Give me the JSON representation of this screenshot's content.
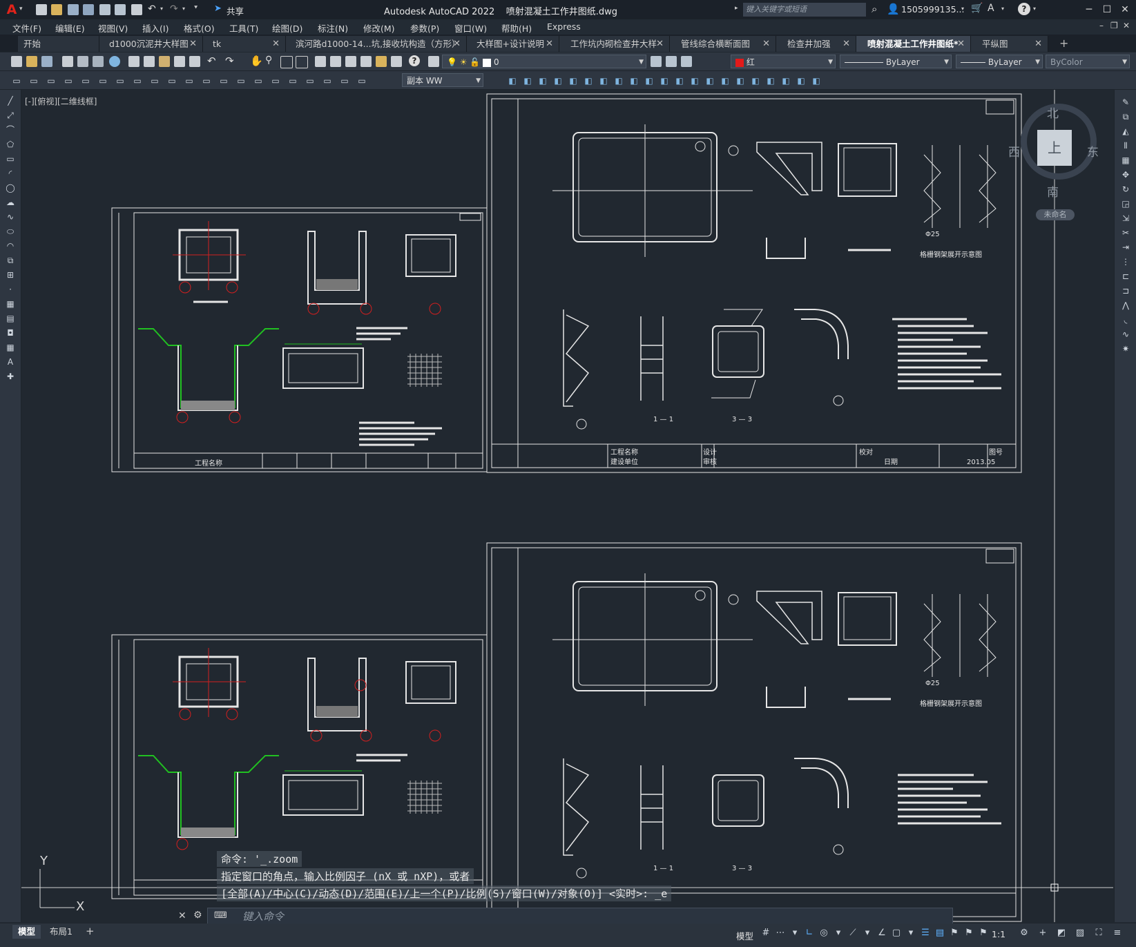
{
  "app": {
    "title": "Autodesk AutoCAD 2022",
    "filename": "喷射混凝土工作井图纸.dwg",
    "share_label": "共享",
    "search_placeholder": "键入关键字或短语",
    "user": "1505999135...",
    "help": "?"
  },
  "menu": [
    "文件(F)",
    "编辑(E)",
    "视图(V)",
    "插入(I)",
    "格式(O)",
    "工具(T)",
    "绘图(D)",
    "标注(N)",
    "修改(M)",
    "参数(P)",
    "窗口(W)",
    "帮助(H)",
    "Express"
  ],
  "tabs": [
    {
      "label": "开始",
      "active": false,
      "closable": false
    },
    {
      "label": "d1000沉泥井大样图",
      "active": false,
      "closable": true
    },
    {
      "label": "tk",
      "active": false,
      "closable": true
    },
    {
      "label": "滨河路d1000-14...坑,接收坑构造（方形）",
      "active": false,
      "closable": true
    },
    {
      "label": "大样图+设计说明",
      "active": false,
      "closable": true
    },
    {
      "label": "工作坑内砌检查井大样",
      "active": false,
      "closable": true
    },
    {
      "label": "管线综合横断面图",
      "active": false,
      "closable": true
    },
    {
      "label": "检查井加强",
      "active": false,
      "closable": true
    },
    {
      "label": "喷射混凝土工作井图纸*",
      "active": true,
      "closable": true
    },
    {
      "label": "平纵图",
      "active": false,
      "closable": true
    }
  ],
  "toolbar": {
    "layer_value": "0",
    "color_value": "红",
    "linetype_value": "ByLayer",
    "lineweight_value": "ByLayer",
    "plotstyle_value": "ByColor",
    "dimstyle_value": "副本 WW"
  },
  "viewport_label": "[-][俯视][二维线框]",
  "viewcube": {
    "north": "北",
    "south": "南",
    "east": "东",
    "west": "西",
    "face": "上",
    "ucs_name": "未命名"
  },
  "ucs": {
    "y": "Y",
    "x": "X"
  },
  "command": {
    "history": [
      "命令: '_.zoom",
      "指定窗口的角点，输入比例因子 (nX 或 nXP)，或者",
      "[全部(A)/中心(C)/动态(D)/范围(E)/上一个(P)/比例(S)/窗口(W)/对象(O)] <实时>: _e"
    ],
    "placeholder": "键入命令"
  },
  "layout_tabs": [
    "模型",
    "布局1"
  ],
  "status": {
    "model_label": "模型",
    "scale": "1:1"
  },
  "drawing_labels": {
    "grid_sheet_caption": "格栅钢架展开示意图",
    "section_a": "1 — 1",
    "section_b": "3 — 3",
    "name_cell": "工程名称",
    "unit_cell": "建设单位",
    "design_cell": "设计",
    "review_cell": "审核",
    "check_cell": "校对",
    "date_cell": "日期",
    "sheet_no": "图号",
    "date_value": "2013.05",
    "rebar_label": "Φ25"
  },
  "colors": {
    "background": "#212830",
    "titlebar": "#1b2129",
    "toolbar": "#2e3641",
    "accent_red": "#e2231a",
    "drawing_line": "#e8e8e8",
    "green": "#21c021",
    "red_mark": "#d21f1f"
  }
}
